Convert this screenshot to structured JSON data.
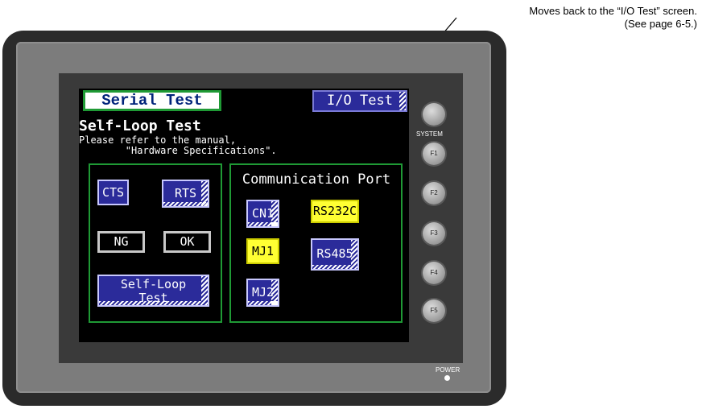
{
  "callout": {
    "line1": "Moves back to the “I/O Test” screen.",
    "line2": "(See page 6-5.)"
  },
  "screen": {
    "title": "Serial Test",
    "io_test_button": "I/O Test",
    "heading": "Self-Loop Test",
    "refer_line1": "Please refer to the manual,",
    "refer_line2": "        \"Hardware Specifications\"."
  },
  "left_panel": {
    "cts": "CTS",
    "rts": "RTS",
    "ng": "NG",
    "ok": "OK",
    "self_loop_line1": "Self-Loop",
    "self_loop_line2": "Test"
  },
  "right_panel": {
    "heading": "Communication Port",
    "cn1": "CN1",
    "rs232c": "RS232C",
    "mj1": "MJ1",
    "rs485": "RS485",
    "mj2": "MJ2"
  },
  "hardware": {
    "system_label": "SYSTEM",
    "f1": "F1",
    "f2": "F2",
    "f3": "F3",
    "f4": "F4",
    "f5": "F5",
    "power_label": "POWER"
  },
  "colors": {
    "panel_border": "#1f9a35",
    "button_blue": "#2b2b9a",
    "button_yellow": "#ffff33",
    "bezel": "#2b2b2b"
  }
}
